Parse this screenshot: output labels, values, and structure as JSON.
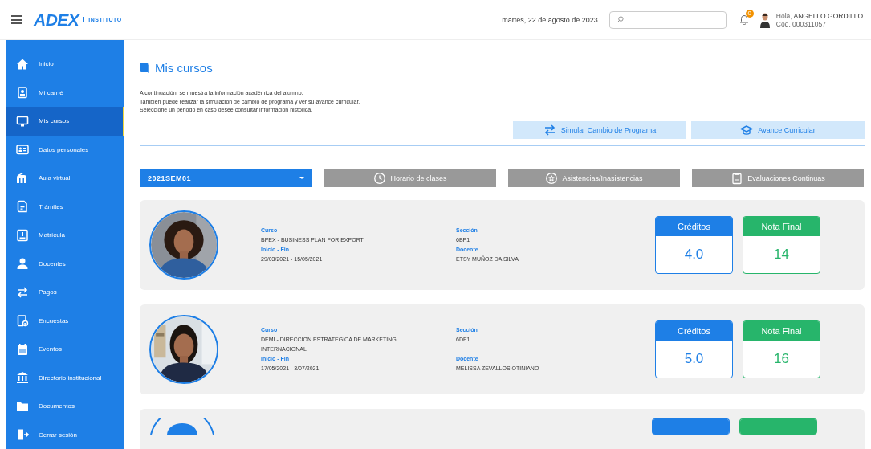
{
  "header": {
    "logo": "ADEX",
    "logo_sub": "INSTITUTO",
    "date": "martes, 22 de agosto de 2023",
    "notifications": "0",
    "greeting": "Hola,",
    "user_name": "ANGELLO GORDILLO",
    "user_code": "Cod. 000311057"
  },
  "sidebar": {
    "items": [
      {
        "label": "Inicio",
        "selected": false
      },
      {
        "label": "Mi carné",
        "selected": false
      },
      {
        "label": "Mis cursos",
        "selected": true
      },
      {
        "label": "Datos personales",
        "selected": false
      },
      {
        "label": "Aula virtual",
        "selected": false
      },
      {
        "label": "Trámites",
        "selected": false
      },
      {
        "label": "Matrícula",
        "selected": false
      },
      {
        "label": "Docentes",
        "selected": false
      },
      {
        "label": "Pagos",
        "selected": false
      },
      {
        "label": "Encuestas",
        "selected": false
      },
      {
        "label": "Eventos",
        "selected": false
      },
      {
        "label": "Directorio institucional",
        "selected": false
      },
      {
        "label": "Documentos",
        "selected": false
      },
      {
        "label": "Cerrar sesión",
        "selected": false
      }
    ]
  },
  "page": {
    "title": "Mis cursos",
    "intro": [
      "A continuación, se muestra la información académica del alumno.",
      "También puede realizar la simulación de cambio de programa y ver su avance curricular.",
      "Seleccione un periodo en caso desee consultar información histórica."
    ],
    "actions": [
      "Simular Cambio de Programa",
      "Avance Curricular"
    ],
    "period": "2021SEM01",
    "tools": [
      "Horario de clases",
      "Asistencias/Inasistencias",
      "Evaluaciones Continuas"
    ]
  },
  "courses": [
    {
      "course_label": "Curso",
      "course": "BPEX - BUSINESS PLAN FOR EXPORT",
      "dates_label": "Inicio - Fin",
      "dates": "29/03/2021 - 15/05/2021",
      "section_label": "Sección",
      "section": "6BP1",
      "teacher_label": "Docente",
      "teacher": "ETSY MUÑOZ DA SILVA",
      "credits_label": "Créditos",
      "credits": "4.0",
      "grade_label": "Nota Final",
      "grade": "14"
    },
    {
      "course_label": "Curso",
      "course": "DEMI - DIRECCION ESTRATEGICA DE MARKETING INTERNACIONAL",
      "dates_label": "Inicio - Fin",
      "dates": "17/05/2021 - 3/07/2021",
      "section_label": "Sección",
      "section": "6DE1",
      "teacher_label": "Docente",
      "teacher": "MELISSA ZEVALLOS OTINIANO",
      "credits_label": "Créditos",
      "credits": "5.0",
      "grade_label": "Nota Final",
      "grade": "16"
    }
  ]
}
